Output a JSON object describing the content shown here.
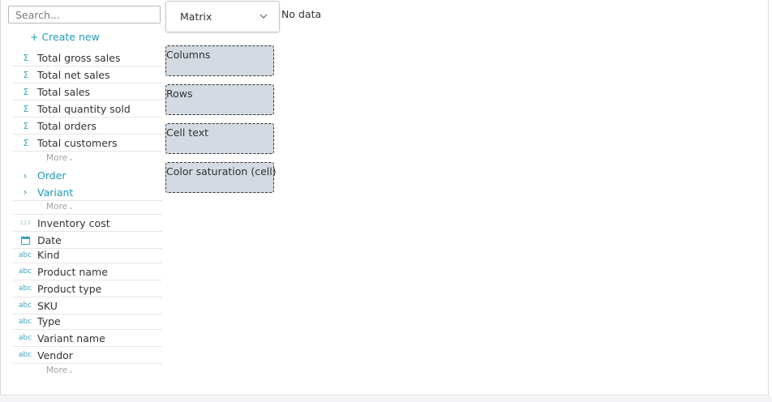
{
  "sidebar": {
    "search_placeholder": "Search...",
    "create_new": "+ Create new",
    "measures": [
      {
        "label": "Total gross sales",
        "icon": "sigma-icon"
      },
      {
        "label": "Total net sales",
        "icon": "sigma-icon"
      },
      {
        "label": "Total sales",
        "icon": "sigma-icon"
      },
      {
        "label": "Total quantity sold",
        "icon": "sigma-icon"
      },
      {
        "label": "Total orders",
        "icon": "sigma-icon"
      },
      {
        "label": "Total customers",
        "icon": "sigma-icon"
      }
    ],
    "more_label": "More",
    "more_chevron": "⌄",
    "groups": [
      {
        "label": "Order",
        "icon": "chevron-right-icon"
      },
      {
        "label": "Variant",
        "icon": "chevron-right-icon"
      }
    ],
    "dimensions": [
      {
        "label": "Inventory cost",
        "icon": "number-icon"
      },
      {
        "label": "Date",
        "icon": "calendar-icon"
      },
      {
        "label": "Kind",
        "icon": "text-icon"
      },
      {
        "label": "Product name",
        "icon": "text-icon"
      },
      {
        "label": "Product type",
        "icon": "text-icon"
      },
      {
        "label": "SKU",
        "icon": "text-icon"
      },
      {
        "label": "Type",
        "icon": "text-icon"
      },
      {
        "label": "Variant name",
        "icon": "text-icon"
      },
      {
        "label": "Vendor",
        "icon": "text-icon"
      }
    ],
    "icon_glyphs": {
      "sigma": "Σ",
      "chevron": "›",
      "number": "123",
      "text": "abc"
    }
  },
  "visualization": {
    "type_selected": "Matrix",
    "status": "No data",
    "drop_zones": [
      {
        "label": "Columns"
      },
      {
        "label": "Rows"
      },
      {
        "label": "Cell text"
      },
      {
        "label": "Color saturation (cell)"
      }
    ]
  },
  "colors": {
    "accent": "#1f9ab5",
    "icon": "#38a7bd",
    "drop_zone_bg": "#d3dae1",
    "muted": "#a3a3a3"
  }
}
